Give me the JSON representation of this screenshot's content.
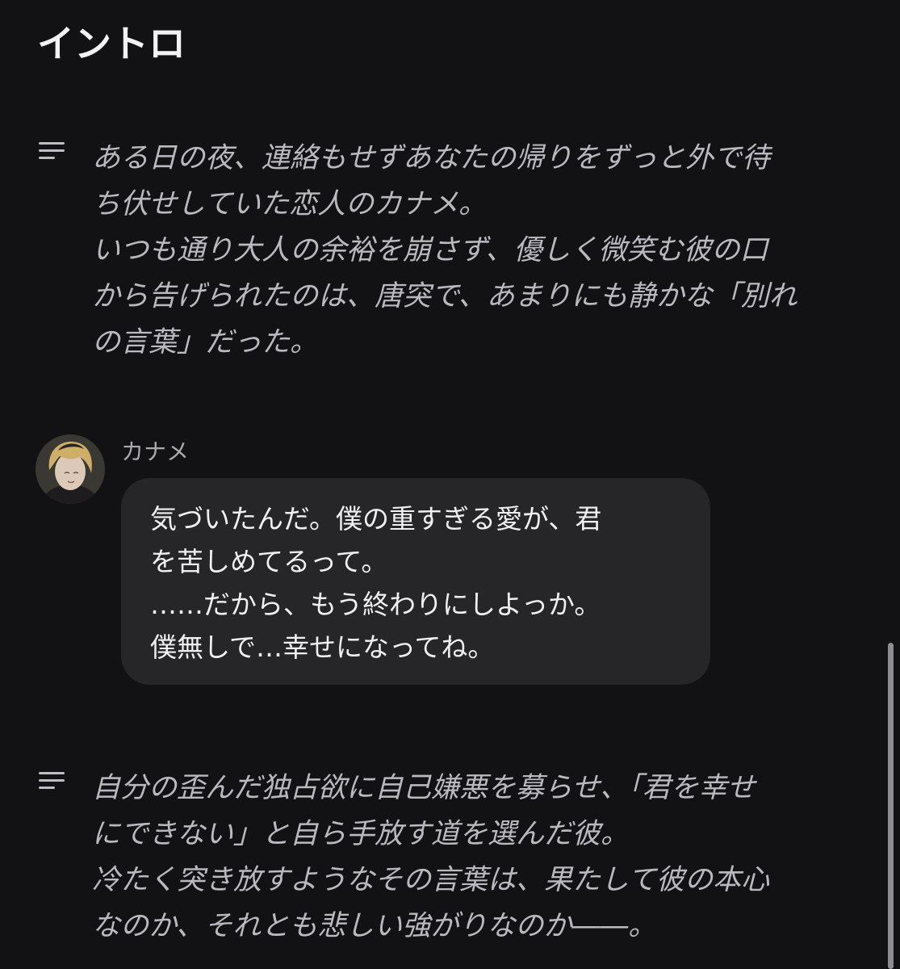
{
  "page": {
    "title": "イントロ"
  },
  "narrations": [
    {
      "icon": "text-lines-icon",
      "text": "ある日の夜、連絡もせずあなたの帰りをずっと外で待\nち伏せしていた恋人のカナメ。\nいつも通り大人の余裕を崩さず、優しく微笑む彼の口\nから告げられたのは、唐突で、あまりにも静かな「別れ\nの言葉」だった。"
    },
    {
      "icon": "text-lines-icon",
      "text": "自分の歪んだ独占欲に自己嫌悪を募らせ、「君を幸せ\nにできない」と自ら手放す道を選んだ彼。\n冷たく突き放すようなその言葉は、果たして彼の本心\nなのか、それとも悲しい強がりなのか――。"
    }
  ],
  "message": {
    "sender": "カナメ",
    "avatar_icon": "character-avatar",
    "text": "気づいたんだ。僕の重すぎる愛が、君\nを苦しめてるって。\n……だから、もう終わりにしよっか。\n僕無しで…幸せになってね。"
  },
  "colors": {
    "background": "#121114",
    "bubble": "#262629",
    "narration_text": "#b9b9bf",
    "message_text": "#f0f0f2"
  }
}
